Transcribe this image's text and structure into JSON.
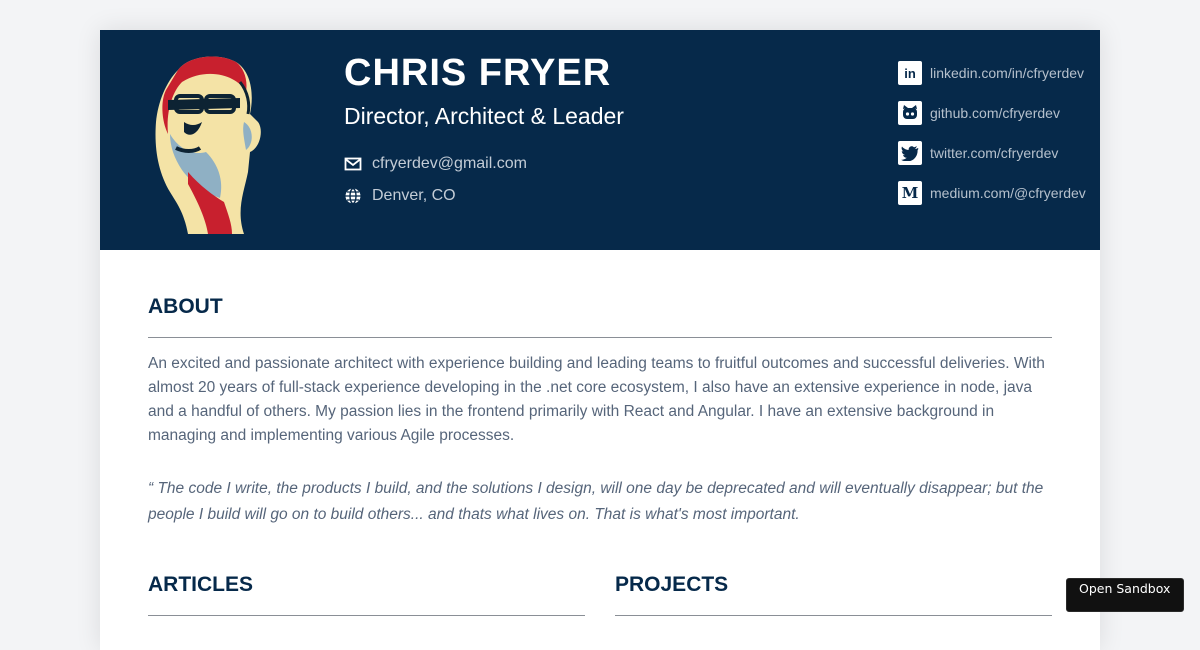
{
  "profile": {
    "name": "CHRIS FRYER",
    "role": "Director, Architect & Leader",
    "email": "cfryerdev@gmail.com",
    "location": "Denver, CO"
  },
  "social": [
    {
      "icon": "linkedin-icon",
      "glyph": "in",
      "label": "linkedin.com/in/cfryerdev"
    },
    {
      "icon": "github-icon",
      "glyph": "gh",
      "label": "github.com/cfryerdev"
    },
    {
      "icon": "twitter-icon",
      "glyph": "tw",
      "label": "twitter.com/cfryerdev"
    },
    {
      "icon": "medium-icon",
      "glyph": "M",
      "label": "medium.com/@cfryerdev"
    }
  ],
  "about": {
    "title": "ABOUT",
    "text": "An excited and passionate architect with experience building and leading teams to fruitful outcomes and successful deliveries. With almost 20 years of full-stack experience developing in the .net core ecosystem, I also have an extensive experience in node, java and a handful of others. My passion lies in the frontend primarily with React and Angular. I have an extensive background in managing and implementing various Agile processes.",
    "quote": "“ The code I write, the products I build, and the solutions I design, will one day be deprecated and will eventually disappear; but the people I build will go on to build others... and thats what lives on. That is what's most important."
  },
  "sections": {
    "articles_title": "ARTICLES",
    "projects_title": "PROJECTS"
  },
  "sandbox": {
    "label": "Open Sandbox"
  },
  "colors": {
    "header_bg": "#06294a",
    "accent_text": "#06294a",
    "body_text": "#56657a"
  }
}
